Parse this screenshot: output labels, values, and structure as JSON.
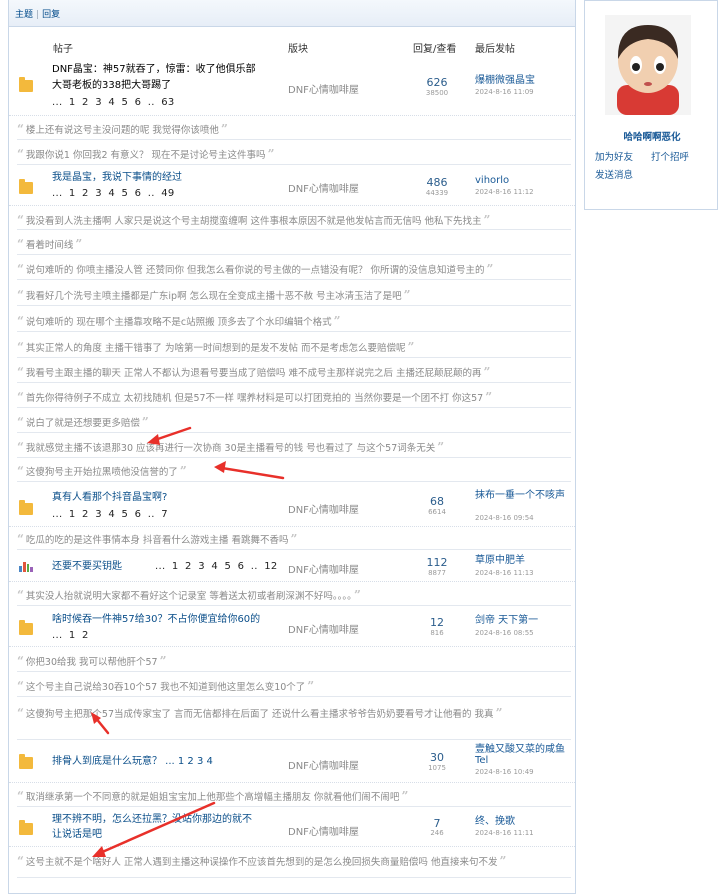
{
  "tabs": {
    "topics": "主题",
    "separator": "|",
    "replies": "回复"
  },
  "columns": {
    "post": "帖子",
    "forum": "版块",
    "replies_views": "回复/查看",
    "last_post": "最后发帖"
  },
  "threads": [
    {
      "title_line1": "DNF晶宝：神57就吞了，惊雷：收了他俱乐部",
      "title_line2": "大哥老板的338把大哥踢了",
      "pager": "... 1 2 3 4 5 6 .. 63",
      "forum": "DNF心情咖啡屋",
      "replies": "626",
      "views": "38500",
      "last_user": "爆棚微强晶宝",
      "last_time": "2024-8-16 11:09",
      "icon": "folder"
    },
    {
      "title_line1": "我是晶宝，我说下事情的经过",
      "title_line2": "",
      "pager": "... 1 2 3 4 5 6 .. 49",
      "forum": "DNF心情咖啡屋",
      "replies": "486",
      "views": "44339",
      "last_user": "vihorlo",
      "last_time": "2024-8-16 11:12",
      "icon": "folder"
    },
    {
      "title_line1": "真有人看那个抖音晶宝啊?",
      "title_line2": "",
      "pager": "... 1 2 3 4 5 6 .. 7",
      "forum": "DNF心情咖啡屋",
      "replies": "68",
      "views": "6614",
      "last_user": "抹布一垂一个不咳声",
      "last_time": "2024-8-16 09:54",
      "icon": "folder"
    },
    {
      "title_line1": "还要不要买钥匙",
      "title_line2": "",
      "pager": "... 1 2 3 4 5 6 .. 12",
      "forum": "DNF心情咖啡屋",
      "replies": "112",
      "views": "8877",
      "last_user": "草原中肥羊",
      "last_time": "2024-8-16 11:13",
      "icon": "bars"
    },
    {
      "title_line1": "啥时候吞一件神57给30？不占你便宜给你60的",
      "title_line2": "",
      "pager": "... 1 2",
      "forum": "DNF心情咖啡屋",
      "replies": "12",
      "views": "816",
      "last_user": "剑帝 天下第一",
      "last_time": "2024-8-16 08:55",
      "icon": "folder"
    },
    {
      "title_line1": "排骨人到底是什么玩意？ ... 1 2 3 4",
      "title_line2": "",
      "pager": "",
      "forum": "DNF心情咖啡屋",
      "replies": "30",
      "views": "1075",
      "last_user": "壹触又酸又菜的咸鱼Tel",
      "last_time": "2024-8-16 10:49",
      "icon": "folder"
    },
    {
      "title_line1": "理不辨不明，怎么还拉黑？没站你那边的就不",
      "title_line2": "让说话是吧",
      "pager": "",
      "forum": "DNF心情咖啡屋",
      "replies": "7",
      "views": "246",
      "last_user": "终、挽歌",
      "last_time": "2024-8-16 11:11",
      "icon": "folder"
    }
  ],
  "quotes": [
    "楼上还有说这号主没问题的呢 我觉得你该喷他",
    "我跟你说1 你回我2 有意义？ 现在不是讨论号主这件事吗",
    "我没看到人洗主播啊 人家只是说这个号主胡搅蛮缠啊 这件事根本原因不就是他发帖言而无信吗 他私下先找主",
    "看着时间线",
    "说句难听的 你喷主播没人管 还赞同你 但我怎么看你说的号主做的一点错没有呢？ 你所谓的没信息知道号主的",
    "我看好几个洗号主喷主播都是广东ip啊 怎么现在全变成主播十恶不赦 号主冰清玉洁了是吧",
    "说句难听的 现在哪个主播靠攻略不是c站照搬 顶多去了个水印编辑个格式",
    "其实正常人的角度 主播干错事了 为啥第一时间想到的是发不发帖 而不是考虑怎么要赔偿呢",
    "我看号主跟主播的聊天 正常人不都认为退看号要当成了赔偿吗 难不成号主那样说完之后 主播还屁颠屁颠的再",
    "首先你得待例子不成立 太初找随机 但是57不一样 嘿养材料是可以打团竞拍的 当然你要是一个团不打 你这57",
    "说白了就是还想要更多赔偿",
    "我就感觉主播不该退那30 应该再进行一次协商 30是主播看号的钱 号也看过了 与这个57词条无关",
    "这傻狗号主开始拉黑喷他没信誉的了",
    "吃瓜的吃的是这件事情本身 抖音看什么游戏主播 看跳舞不香吗",
    "其实没人抬就说明大家都不看好这个记录室 等着送太初或者刷深渊不好吗。。。。",
    "你把30给我 我可以帮他肝个57",
    "这个号主自己说给30吞10个57 我也不知道到他这里怎么变10个了",
    "这傻狗号主把那个57当成传家宝了 言而无信都排在后面了 还说什么看主播求爷爷告奶奶要看号才让他看的 我真",
    "取消继承第一个不同意的就是姐姐宝宝加上他那些个高增幅主播朋友 你就看他们闹不闹吧",
    "这号主就不是个啥好人 正常人遇到主播这种误操作不应该首先想到的是怎么挽回损失商量赔偿吗 他直接来句不发"
  ],
  "user_card": {
    "username": "哈哈啊啊恶化",
    "add_friend": "加为好友",
    "greet": "打个招呼",
    "send_message": "发送消息"
  },
  "colors": {
    "link": "#1a5a97",
    "folder": "#f3b93c",
    "arrow": "#e8302a",
    "border": "#c9d7e8"
  }
}
